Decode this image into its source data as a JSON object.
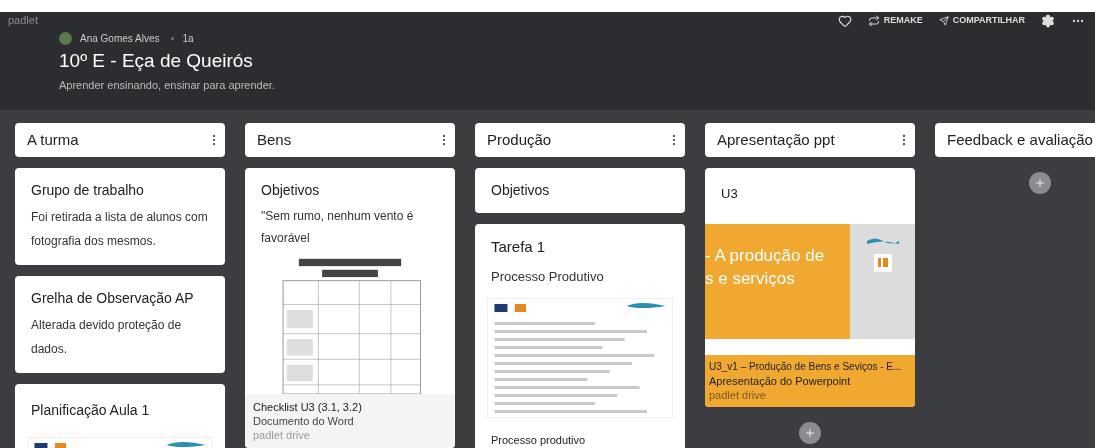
{
  "brand": "padlet",
  "author": {
    "name": "Ana Gomes Alves",
    "age": "1a"
  },
  "title": "10º E - Eça de Queirós",
  "subtitle": "Aprender ensinando, ensinar para aprender.",
  "actions": [
    {
      "kind": "like"
    },
    {
      "kind": "remake",
      "label": "REMAKE"
    },
    {
      "kind": "share",
      "label": "COMPARTILHAR"
    },
    {
      "kind": "settings"
    },
    {
      "kind": "more"
    }
  ],
  "columns": [
    {
      "title": "A turma",
      "menu": true,
      "cards": [
        {
          "kind": "text",
          "title": "Grupo de trabalho",
          "body": "Foi retirada a lista de alunos com fotografia dos mesmos."
        },
        {
          "kind": "text",
          "title": "Grelha de Observação AP",
          "body": "Alterada devido proteção de dados."
        },
        {
          "kind": "doc",
          "title": "Planificação Aula 1"
        }
      ]
    },
    {
      "title": "Bens",
      "menu": true,
      "cards": [
        {
          "kind": "attachment",
          "title": "Objetivos",
          "body": "\"Sem rumo, nenhum vento é favorável",
          "file": "Checklist U3 (3.1, 3.2)",
          "type": "Documento do Word",
          "source": "padlet drive"
        }
      ]
    },
    {
      "title": "Produção",
      "menu": true,
      "cards": [
        {
          "kind": "text",
          "title": "Objetivos"
        },
        {
          "kind": "task",
          "title": "Tarefa 1",
          "subtitle": "Processo Produtivo",
          "footer": "Processo produtivo"
        }
      ]
    },
    {
      "title": "Apresentação ppt",
      "menu": true,
      "add": true,
      "cards": [
        {
          "kind": "slide",
          "title": "U3",
          "slide_lines": [
            "- A produção de",
            "s e serviços"
          ],
          "file": "U3_v1 – Produção de Bens e Seviços - E...",
          "type": "Apresentação do Powerpoint",
          "source": "padlet drive"
        }
      ]
    },
    {
      "title": "Feedback e avaliação",
      "menu": false,
      "add": true
    }
  ]
}
